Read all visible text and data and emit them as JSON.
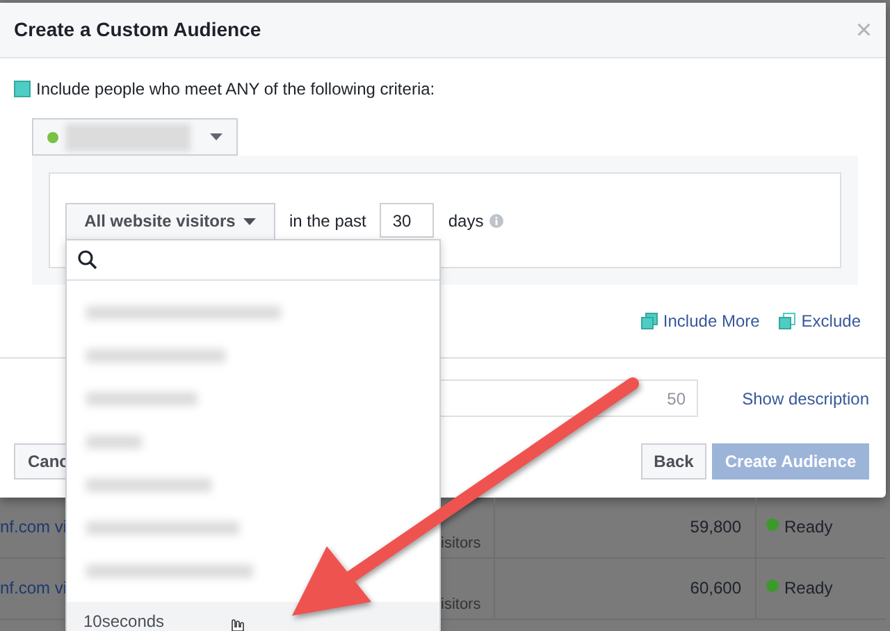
{
  "dialog": {
    "title": "Create a Custom Audience",
    "close": "×"
  },
  "criteria": {
    "label": "Include people who meet ANY of the following criteria:",
    "checked": true
  },
  "pixel_select": {
    "color": "#7ac143"
  },
  "rule": {
    "dropdown_label": "All website visitors",
    "prefix": "in the past",
    "days": "30",
    "suffix": "days"
  },
  "actions": [
    {
      "label": "Include More",
      "kind": "include"
    },
    {
      "label": "Exclude",
      "kind": "exclude"
    }
  ],
  "name_field": {
    "counter": "50"
  },
  "show_description": "Show description",
  "buttons": {
    "cancel": "Canc",
    "back": "Back",
    "create": {
      "label": "Create Audience",
      "disabled": true
    }
  },
  "dropdown_menu": {
    "items": [
      {
        "kind": "redacted",
        "highlighted": false
      },
      {
        "kind": "redacted",
        "highlighted": false
      },
      {
        "kind": "redacted",
        "highlighted": false
      },
      {
        "kind": "redacted",
        "highlighted": false
      },
      {
        "kind": "redacted",
        "highlighted": false
      },
      {
        "kind": "redacted",
        "highlighted": false
      },
      {
        "kind": "redacted",
        "highlighted": false
      },
      {
        "kind": "option",
        "label": "10seconds",
        "highlighted": true
      }
    ]
  },
  "background_table": {
    "rows": [
      {
        "name": "nf.com vi",
        "type": "isitors",
        "size": "59,800",
        "status": "Ready",
        "color": "#3b9a2a"
      },
      {
        "name": "nf.com vi",
        "type": "isitors",
        "size": "60,600",
        "status": "Ready",
        "color": "#3b9a2a"
      }
    ]
  }
}
